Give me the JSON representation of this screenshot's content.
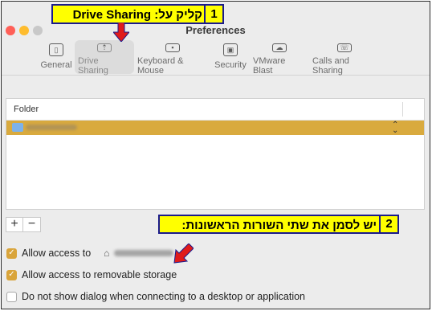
{
  "window": {
    "title": "Preferences"
  },
  "toolbar": {
    "items": [
      {
        "label": "General",
        "icon": "general-icon"
      },
      {
        "label": "Drive Sharing",
        "icon": "folder-share-icon",
        "active": true
      },
      {
        "label": "Keyboard & Mouse",
        "icon": "keyboard-icon"
      },
      {
        "label": "Security",
        "icon": "lock-icon"
      },
      {
        "label": "VMware Blast",
        "icon": "cloud-icon"
      },
      {
        "label": "Calls and Sharing",
        "icon": "phone-icon"
      }
    ]
  },
  "folder_table": {
    "column_header": "Folder"
  },
  "buttons": {
    "add": "+",
    "remove": "−"
  },
  "options": {
    "allow_access_to": "Allow access to",
    "allow_removable": "Allow access to removable storage",
    "no_dialog": "Do not show dialog when connecting to a desktop or application",
    "allow_access_to_checked": true,
    "allow_removable_checked": true,
    "no_dialog_checked": false
  },
  "annotations": {
    "callout1_number": "1",
    "callout1_text": "קליק על: Drive Sharing",
    "callout2_number": "2",
    "callout2_text": "יש לסמן את שתי השורות הראשונות:"
  },
  "colors": {
    "selection": "#d9aa3e",
    "checkbox_accent": "#d9a43a",
    "callout_fill": "#ffff00",
    "callout_border": "#1a1a8c",
    "arrow": "#e01b1b"
  }
}
